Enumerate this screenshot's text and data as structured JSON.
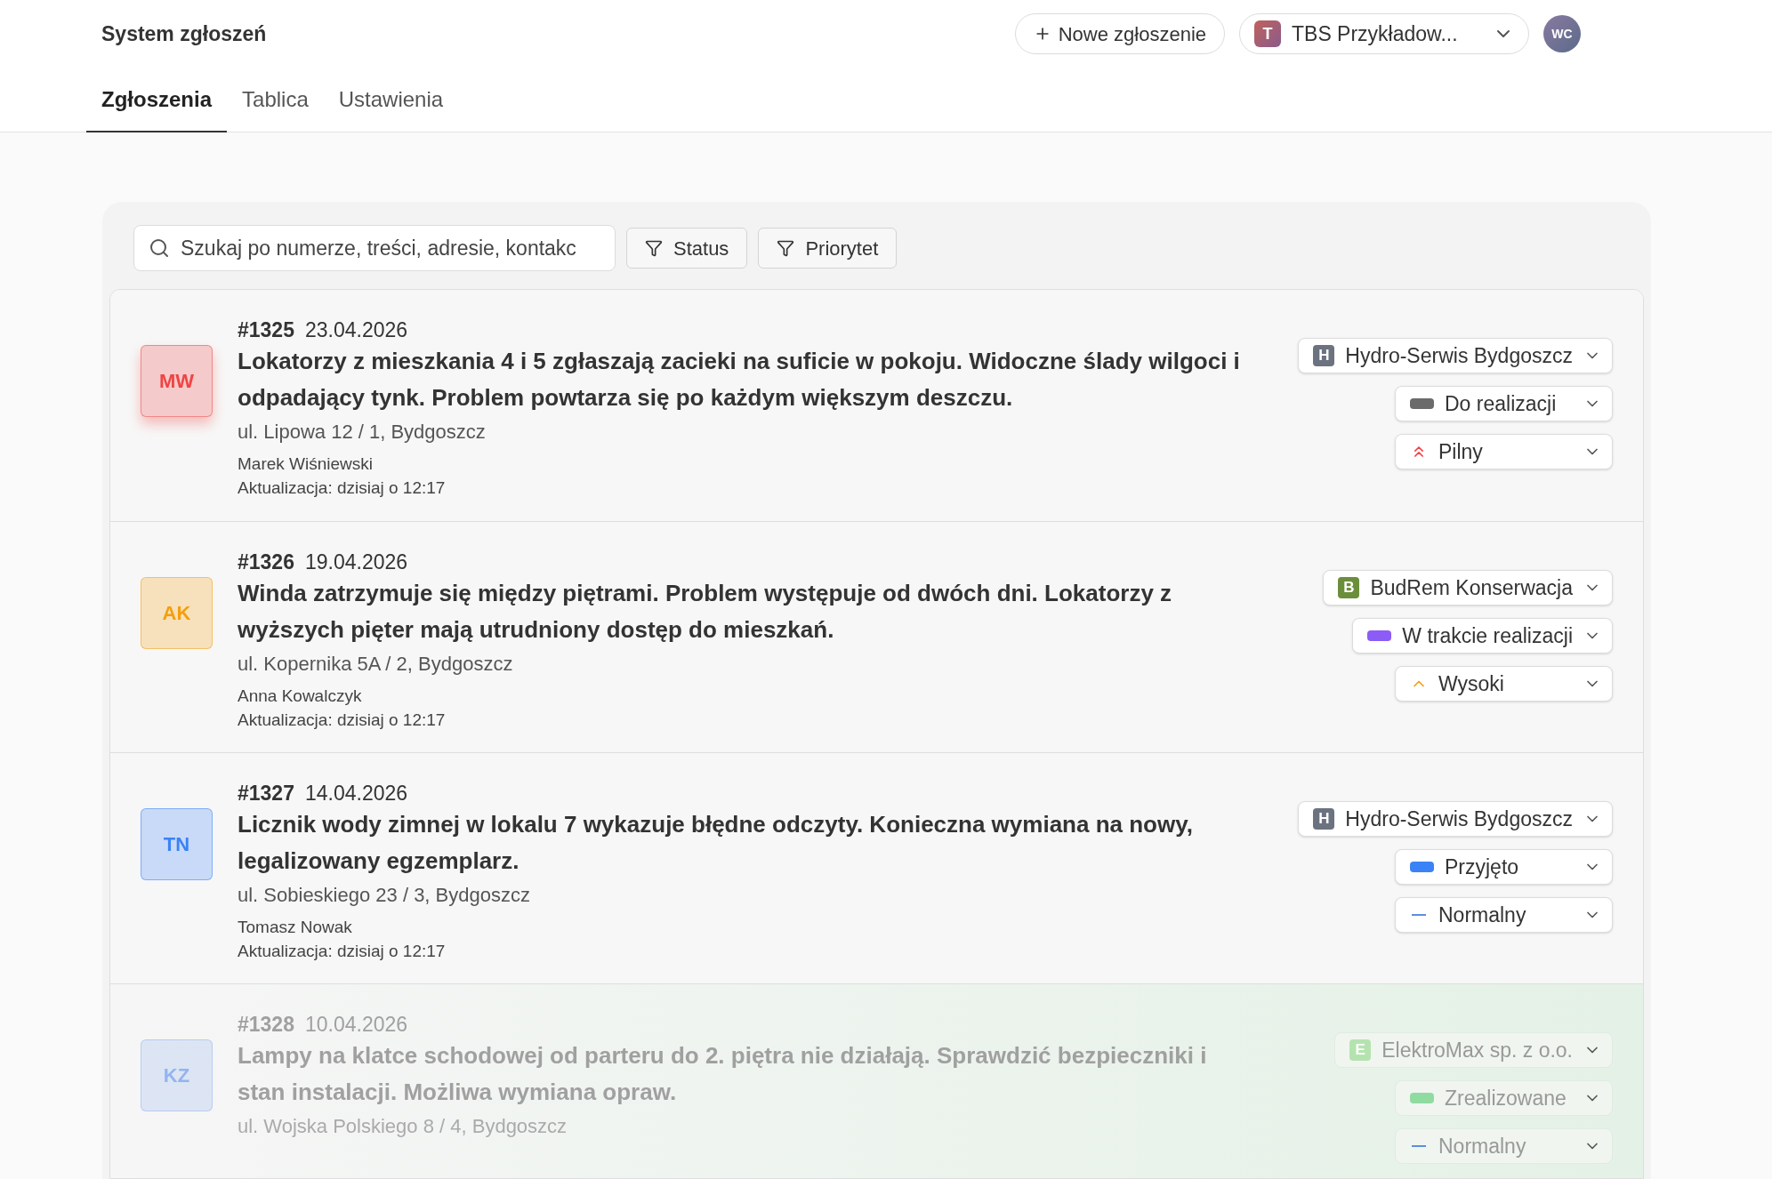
{
  "header": {
    "title": "System zgłoszeń",
    "new_button": "Nowe zgłoszenie",
    "org": {
      "letter": "T",
      "name": "TBS Przykładow..."
    },
    "user_initials": "WC"
  },
  "tabs": [
    {
      "label": "Zgłoszenia",
      "selected": true
    },
    {
      "label": "Tablica",
      "selected": false
    },
    {
      "label": "Ustawienia",
      "selected": false
    }
  ],
  "search": {
    "placeholder": "Szukaj po numerze, treści, adresie, kontakc"
  },
  "filters": [
    "Status",
    "Priorytet"
  ],
  "tickets": [
    {
      "initials": "MW",
      "color": "#ef4444",
      "number": "#1325",
      "date": "23.04.2026",
      "text": "Lokatorzy z mieszkania 4 i 5 zgłaszają zacieki na suficie w pokoju. Widoczne ślady wilgoci i odpadający tynk. Problem powtarza się po każdym większym deszczu.",
      "address": "ul. Lipowa 12 / 1, Bydgoszcz",
      "person": "Marek Wiśniewski",
      "updated": "Aktualizacja: dzisiaj o 12:17",
      "done": false,
      "contractor": {
        "letter": "H",
        "name": "Hydro-Serwis Bydgoszcz",
        "color": "#6b7280"
      },
      "status": {
        "label": "Do realizacji",
        "color": "#6b6b6b"
      },
      "priority": {
        "kind": "urgent",
        "label": "Pilny"
      }
    },
    {
      "initials": "AK",
      "color": "#f59e0b",
      "number": "#1326",
      "date": "19.04.2026",
      "text": "Winda zatrzymuje się między piętrami. Problem występuje od dwóch dni. Lokatorzy z wyższych pięter mają utrudniony dostęp do mieszkań.",
      "address": "ul. Kopernika 5A / 2, Bydgoszcz",
      "person": "Anna Kowalczyk",
      "updated": "Aktualizacja: dzisiaj o 12:17",
      "done": false,
      "contractor": {
        "letter": "B",
        "name": "BudRem Konserwacja",
        "color": "#6b8e3a"
      },
      "status": {
        "label": "W trakcie realizacji",
        "color": "#8b5cf6"
      },
      "priority": {
        "kind": "high",
        "label": "Wysoki"
      }
    },
    {
      "initials": "TN",
      "color": "#3b82f6",
      "number": "#1327",
      "date": "14.04.2026",
      "text": "Licznik wody zimnej w lokalu 7 wykazuje błędne odczyty. Konieczna wymiana na nowy, legalizowany egzemplarz.",
      "address": "ul. Sobieskiego 23 / 3, Bydgoszcz",
      "person": "Tomasz Nowak",
      "updated": "Aktualizacja: dzisiaj o 12:17",
      "done": false,
      "contractor": {
        "letter": "H",
        "name": "Hydro-Serwis Bydgoszcz",
        "color": "#6b7280"
      },
      "status": {
        "label": "Przyjęto",
        "color": "#3b82f6"
      },
      "priority": {
        "kind": "normal",
        "label": "Normalny"
      }
    },
    {
      "initials": "KZ",
      "color": "#93b4f0",
      "number": "#1328",
      "date": "10.04.2026",
      "text": "Lampy na klatce schodowej od parteru do 2. piętra nie działają. Sprawdzić bezpieczniki i stan instalacji. Możliwa wymiana opraw.",
      "address": "ul. Wojska Polskiego 8 / 4, Bydgoszcz",
      "done": true,
      "contractor": {
        "letter": "E",
        "name": "ElektroMax sp. z o.o.",
        "color": "#b5e3b0"
      },
      "status": {
        "label": "Zrealizowane",
        "color": "#8fdba0"
      },
      "priority": {
        "kind": "normal",
        "label": "Normalny"
      }
    }
  ]
}
